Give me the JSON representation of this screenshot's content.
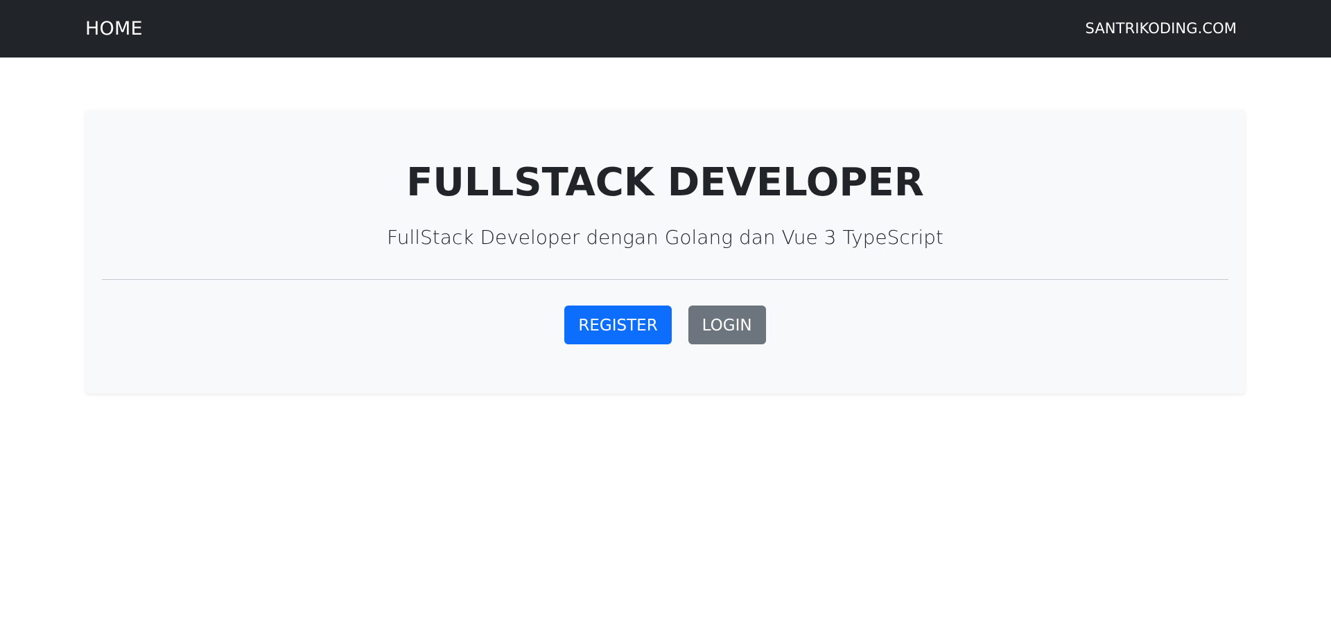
{
  "navbar": {
    "brand": "HOME",
    "link": "SANTRIKODING.COM"
  },
  "hero": {
    "title": "FULLSTACK DEVELOPER",
    "subtitle": "FullStack Developer dengan Golang dan Vue 3 TypeScript",
    "register_label": "REGISTER",
    "login_label": "LOGIN"
  },
  "colors": {
    "navbar_bg": "#212529",
    "hero_bg": "#f8f9fa",
    "primary": "#0d6efd",
    "secondary": "#6c757d"
  }
}
